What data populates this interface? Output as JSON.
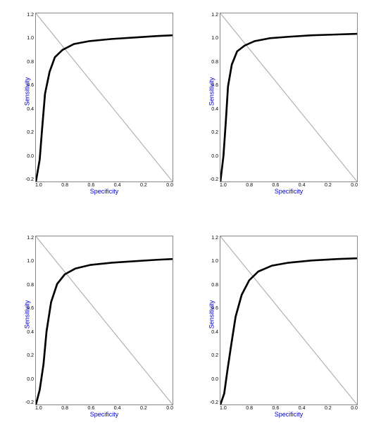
{
  "charts": [
    {
      "id": "chart-top-left",
      "x_label": "Specificity",
      "y_label": "Sensitivity",
      "x_ticks": [
        "1.0",
        "0.8",
        "0.6",
        "0.4",
        "0.2",
        "0.0"
      ],
      "y_ticks": [
        "1.2",
        "1.0",
        "0.8",
        "0.6",
        "0.4",
        "0.2",
        "0.0",
        "-0.2"
      ]
    },
    {
      "id": "chart-top-right",
      "x_label": "Specificity",
      "y_label": "Sensitivity",
      "x_ticks": [
        "1.0",
        "0.8",
        "0.6",
        "0.4",
        "0.2",
        "0.0"
      ],
      "y_ticks": [
        "1.2",
        "1.0",
        "0.8",
        "0.6",
        "0.4",
        "0.2",
        "0.0",
        "-0.2"
      ]
    },
    {
      "id": "chart-bottom-left",
      "x_label": "Specificity",
      "y_label": "Sensitivity",
      "x_ticks": [
        "1.0",
        "0.8",
        "0.6",
        "0.4",
        "0.2",
        "0.0"
      ],
      "y_ticks": [
        "1.2",
        "1.0",
        "0.8",
        "0.6",
        "0.4",
        "0.2",
        "0.0",
        "-0.2"
      ]
    },
    {
      "id": "chart-bottom-right",
      "x_label": "Specificity",
      "y_label": "Sensitivity",
      "x_ticks": [
        "1.0",
        "0.8",
        "0.6",
        "0.4",
        "0.2",
        "0.0"
      ],
      "y_ticks": [
        "1.2",
        "1.0",
        "0.8",
        "0.6",
        "0.4",
        "0.2",
        "0.0",
        "-0.2"
      ]
    }
  ]
}
